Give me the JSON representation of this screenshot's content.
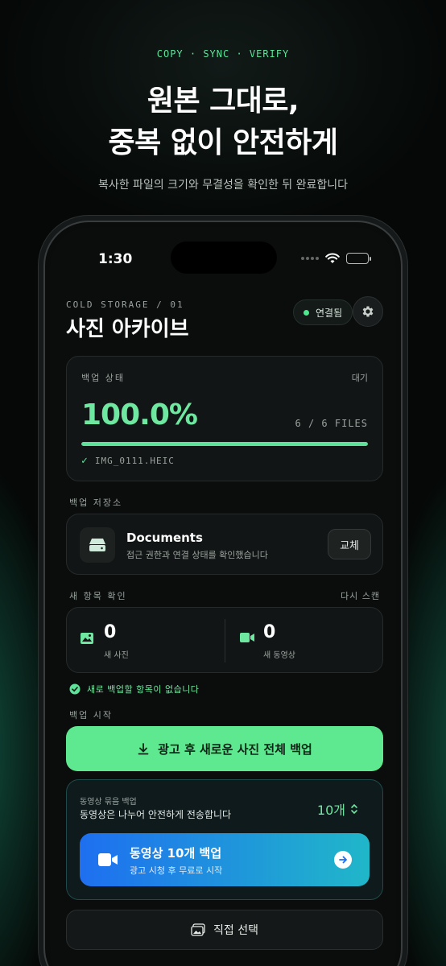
{
  "hero": {
    "eyebrow": "COPY · SYNC · VERIFY",
    "headline_line1": "원본 그대로,",
    "headline_line2": "중복 없이 안전하게",
    "subline": "복사한 파일의 크기와 무결성을 확인한 뒤 완료합니다"
  },
  "status_bar": {
    "time": "1:30",
    "wifi_icon": "wifi-icon",
    "battery_icon": "battery-icon"
  },
  "header": {
    "section_tag": "COLD STORAGE / 01",
    "title": "사진 아카이브",
    "connection_label": "연결됨",
    "settings_icon": "gear-icon"
  },
  "backup_status": {
    "label": "백업 상태",
    "state": "대기",
    "percent_text": "100.0%",
    "progress": 1.0,
    "files_text": "6 / 6 FILES",
    "current_file": "IMG_0111.HEIC"
  },
  "storage": {
    "section_label": "백업 저장소",
    "name": "Documents",
    "description": "접근 권한과 연결 상태를 확인했습니다",
    "swap_label": "교체",
    "icon": "drive-icon"
  },
  "scan": {
    "section_label": "새 항목 확인",
    "rescan_label": "다시 스캔",
    "photos_count": "0",
    "photos_label": "새 사진",
    "videos_count": "0",
    "videos_label": "새 동영상",
    "no_items_text": "새로 백업할 항목이 없습니다"
  },
  "start": {
    "section_label": "백업 시작",
    "cta_label": "광고 후 새로운 사진 전체 백업"
  },
  "video_bundle": {
    "label": "동영상 묶음 백업",
    "description": "동영상은 나누어 안전하게 전송합니다",
    "count_selector": "10개",
    "button_title": "동영상 10개 백업",
    "button_subtitle": "광고 시청 후 무료로 시작"
  },
  "manual": {
    "label": "직접 선택"
  },
  "colors": {
    "accent": "#5ee29a",
    "cta": "#5ee88f",
    "video_start": "#1e6ff0",
    "video_end": "#20b7c9"
  }
}
